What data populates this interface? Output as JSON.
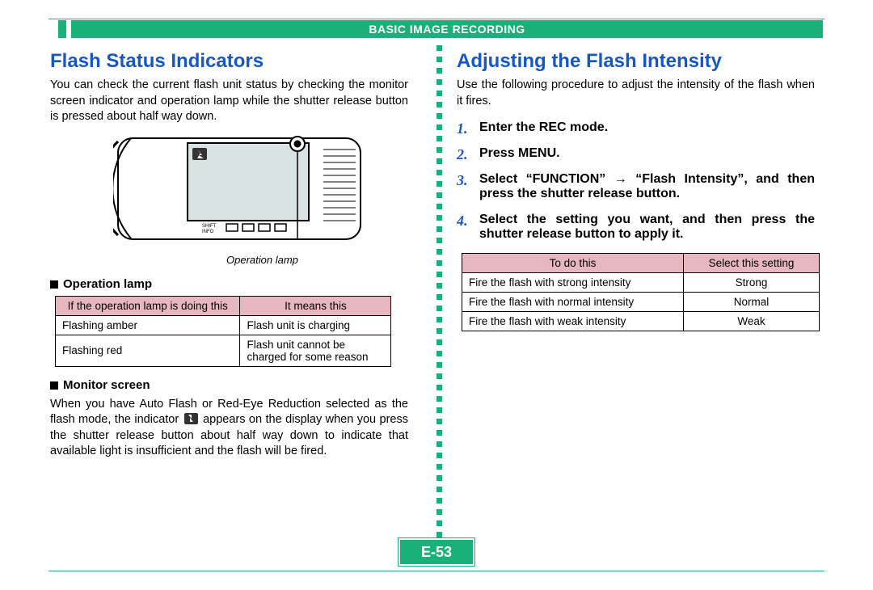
{
  "header": {
    "title": "BASIC IMAGE RECORDING"
  },
  "page_number": "E-53",
  "left": {
    "title": "Flash Status Indicators",
    "intro": "You can check the current flash unit status by checking the monitor screen indicator and operation lamp while the shutter release button is pressed about half way down.",
    "illustration_caption": "Operation lamp",
    "screen_labels": {
      "shift": "SHIFT",
      "info": "INFO"
    },
    "subhead_operation": "Operation lamp",
    "op_table": {
      "h1": "If the operation lamp is doing this",
      "h2": "It means this",
      "rows": [
        {
          "c1": "Flashing amber",
          "c2": "Flash unit is charging"
        },
        {
          "c1": "Flashing red",
          "c2": "Flash unit cannot be charged for some reason"
        }
      ]
    },
    "subhead_monitor": "Monitor screen",
    "monitor_text_a": "When you have Auto Flash or Red-Eye Reduction selected as the flash mode, the indicator ",
    "monitor_text_b": " appears on the display when you press the shutter release button about half way down to indicate that available light is insufficient and the flash will be fired."
  },
  "right": {
    "title": "Adjusting the Flash Intensity",
    "intro": "Use the following procedure to adjust the intensity of the flash when it fires.",
    "steps": [
      "Enter the REC mode.",
      "Press MENU.",
      "Select “FUNCTION” → “Flash Intensity”, and then press the shutter release button.",
      "Select the setting you want, and then press the shutter release button to apply it."
    ],
    "intensity_table": {
      "h1": "To do this",
      "h2": "Select this setting",
      "rows": [
        {
          "c1": "Fire the flash with strong intensity",
          "c2": "Strong"
        },
        {
          "c1": "Fire the flash with normal intensity",
          "c2": "Normal"
        },
        {
          "c1": "Fire the flash with weak intensity",
          "c2": "Weak"
        }
      ]
    }
  }
}
